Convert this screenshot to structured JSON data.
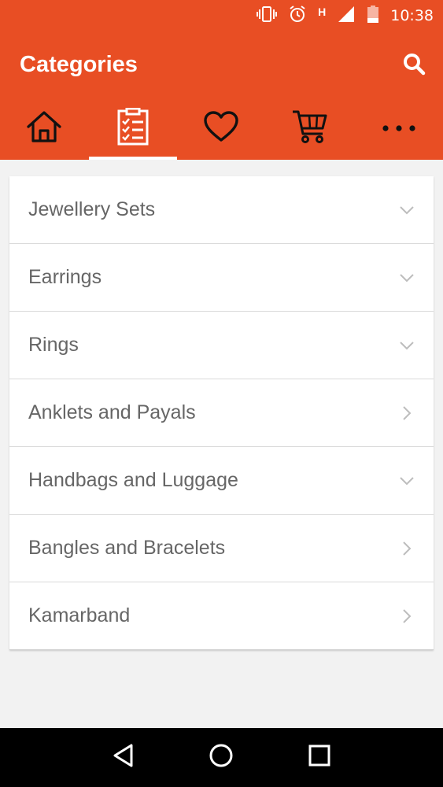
{
  "status_bar": {
    "time": "10:38",
    "network": "H",
    "icons": [
      "vibrate-icon",
      "alarm-icon",
      "signal-icon",
      "battery-icon"
    ]
  },
  "app_bar": {
    "title": "Categories",
    "search_icon": "search-icon"
  },
  "tabs": [
    {
      "icon": "home-icon",
      "active": false
    },
    {
      "icon": "categories-list-icon",
      "active": true
    },
    {
      "icon": "heart-icon",
      "active": false
    },
    {
      "icon": "cart-icon",
      "active": false
    },
    {
      "icon": "more-dots-icon",
      "active": false
    }
  ],
  "categories": [
    {
      "label": "Jewellery Sets",
      "chevron": "down"
    },
    {
      "label": "Earrings",
      "chevron": "down"
    },
    {
      "label": "Rings",
      "chevron": "down"
    },
    {
      "label": "Anklets and Payals",
      "chevron": "right"
    },
    {
      "label": "Handbags and Luggage",
      "chevron": "down"
    },
    {
      "label": "Bangles and Bracelets",
      "chevron": "right"
    },
    {
      "label": "Kamarband",
      "chevron": "right"
    }
  ],
  "colors": {
    "accent": "#e84e24",
    "background": "#f2f2f2",
    "text": "#666666"
  },
  "nav_bar": [
    "back-icon",
    "home-circle-icon",
    "recents-icon"
  ]
}
